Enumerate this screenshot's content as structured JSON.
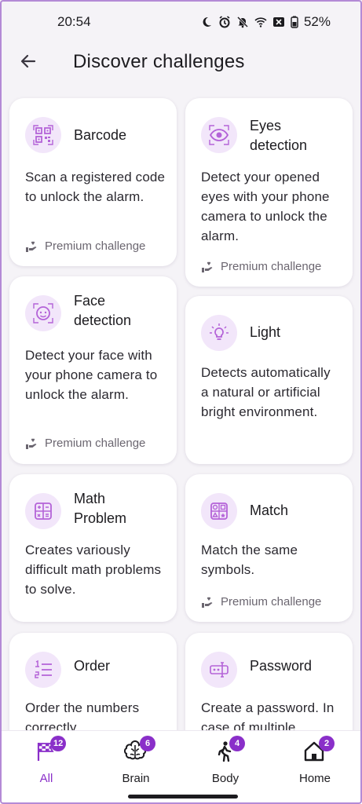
{
  "status_bar": {
    "time": "20:54",
    "battery": "52%",
    "icons": [
      "moon-icon",
      "alarm-icon",
      "bell-off-icon",
      "wifi-icon",
      "battery-saver-icon"
    ]
  },
  "header": {
    "title": "Discover challenges",
    "back_icon": "arrow-left-icon"
  },
  "challenges": [
    {
      "title": "Barcode",
      "icon": "qr-code-icon",
      "description": "Scan a registered code to unlock the alarm.",
      "premium": "Premium challenge"
    },
    {
      "title": "Eyes detection",
      "icon": "eye-icon",
      "description": "Detect your opened eyes with your phone camera to unlock the alarm.",
      "premium": "Premium challenge"
    },
    {
      "title": "Face detection",
      "icon": "face-icon",
      "description": "Detect your face with your phone camera to unlock the alarm.",
      "premium": "Premium challenge"
    },
    {
      "title": "Light",
      "icon": "lightbulb-icon",
      "description": "Detects automatically a natural or artificial bright environment.",
      "premium": null
    },
    {
      "title": "Math Problem",
      "icon": "calculator-icon",
      "description": "Creates variously difficult math problems to solve.",
      "premium": null
    },
    {
      "title": "Match",
      "icon": "match-symbols-icon",
      "description": "Match the same symbols.",
      "premium": "Premium challenge"
    },
    {
      "title": "Order",
      "icon": "ordered-list-icon",
      "description": "Order the numbers correctly.",
      "premium": null
    },
    {
      "title": "Password",
      "icon": "password-icon",
      "description": "Create a password. In case of multiple",
      "premium": null
    }
  ],
  "bottom_nav": [
    {
      "label": "All",
      "icon": "checkered-flag-icon",
      "badge": "12",
      "active": true
    },
    {
      "label": "Brain",
      "icon": "brain-icon",
      "badge": "6",
      "active": false
    },
    {
      "label": "Body",
      "icon": "walking-person-icon",
      "badge": "4",
      "active": false
    },
    {
      "label": "Home",
      "icon": "home-icon",
      "badge": "2",
      "active": false
    }
  ],
  "colors": {
    "accent": "#8a2fc9",
    "icon_bg": "#f2e6fa",
    "background": "#f5f3f7",
    "card": "#ffffff"
  }
}
